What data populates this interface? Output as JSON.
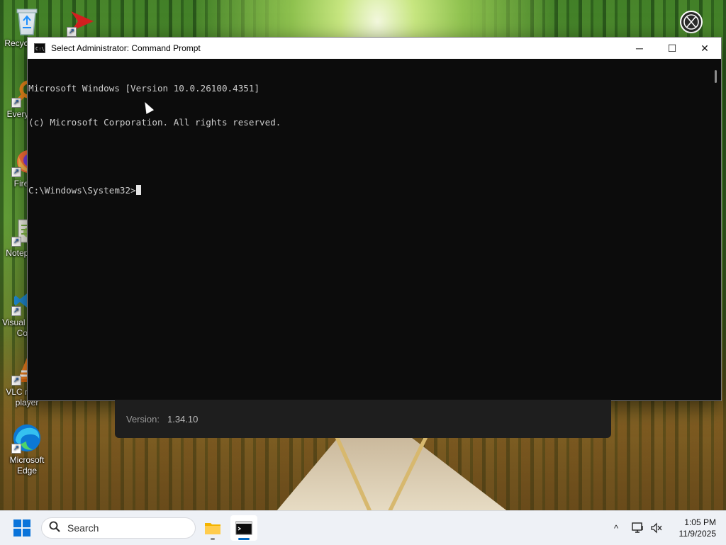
{
  "desktop": {
    "icons": [
      {
        "label": "Recycle Bin",
        "icon": "recycle-bin-icon"
      },
      {
        "label": "Everything",
        "icon": "everything-search-icon"
      },
      {
        "label": "Firefox",
        "icon": "firefox-icon"
      },
      {
        "label": "Notepad++",
        "icon": "notepad-plus-plus-icon"
      },
      {
        "label": "Visual Studio Code",
        "icon": "vscode-icon"
      },
      {
        "label": "VLC media player",
        "icon": "vlc-icon"
      },
      {
        "label": "Microsoft Edge",
        "icon": "edge-icon"
      }
    ]
  },
  "window": {
    "title": "Select Administrator: Command Prompt",
    "icon": "cmd-icon",
    "controls": {
      "minimize": "─",
      "maximize": "☐",
      "close": "✕"
    }
  },
  "console": {
    "lines": [
      "Microsoft Windows [Version 10.0.26100.4351]",
      "(c) Microsoft Corporation. All rights reserved.",
      "",
      "C:\\Windows\\System32>"
    ]
  },
  "version_panel": {
    "label": "Version:",
    "value": "1.34.10"
  },
  "taskbar": {
    "search_placeholder": "Search",
    "apps": [
      {
        "name": "File Explorer",
        "icon": "file-explorer-icon"
      },
      {
        "name": "Command Prompt",
        "icon": "cmd-icon"
      }
    ],
    "tray": {
      "overflow": "^"
    },
    "clock": {
      "time": "1:05 PM",
      "date": "11/9/2025"
    }
  },
  "colors": {
    "accent": "#0067c0",
    "console_bg": "#0c0c0c",
    "console_text": "#cccccc"
  }
}
